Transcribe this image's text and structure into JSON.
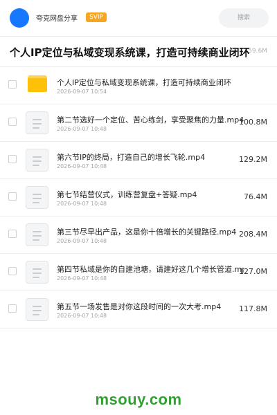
{
  "header": {
    "brand": "夸克网盘分享",
    "badge": "SVIP",
    "search_placeholder": "搜索",
    "avatar_color": "#1677ff"
  },
  "folder": {
    "title": "个人IP定位与私域变现系统课，打造可持续商业闭环",
    "size": "759.6M"
  },
  "files": [
    {
      "name": "个人IP定位与私域变现系统课，打造可持续商业闭环",
      "date": "2026-09-07 10:54",
      "size": "",
      "type": "folder"
    },
    {
      "name": "第二节选好一个定位、苦心练剑，享受聚焦的力量.mp4",
      "date": "2026-09-07 10:48",
      "size": "100.8M",
      "type": "file"
    },
    {
      "name": "第六节IP的终局，打造自己的增长飞轮.mp4",
      "date": "2026-09-07 10:48",
      "size": "129.2M",
      "type": "file"
    },
    {
      "name": "第七节结营仪式，训练营复盘+答疑.mp4",
      "date": "2026-09-07 10:48",
      "size": "76.4M",
      "type": "file"
    },
    {
      "name": "第三节尽早出产品，这是你十倍增长的关键路径.mp4",
      "date": "2026-09-07 10:48",
      "size": "208.4M",
      "type": "file"
    },
    {
      "name": "第四节私域是你的自建池塘，请建好这几个增长管道.mp4",
      "date": "2026-09-07 10:48",
      "size": "127.0M",
      "type": "file"
    },
    {
      "name": "第五节一场发售是对你这段时间的一次大考.mp4",
      "date": "2026-09-07 10:48",
      "size": "117.8M",
      "type": "file"
    }
  ],
  "watermark": "msouy.com"
}
